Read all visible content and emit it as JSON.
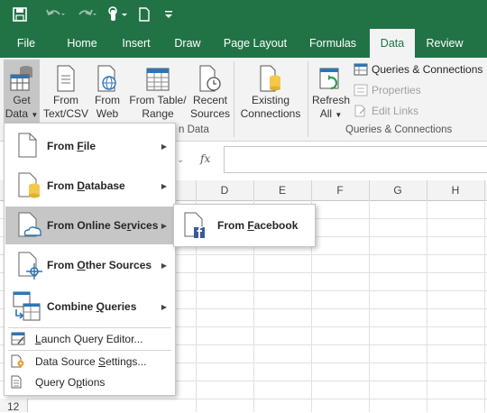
{
  "qat": {
    "undo_icon": "undo-icon",
    "redo_icon": "redo-icon",
    "touch_icon": "touch-mode-icon",
    "new_icon": "new-document-icon"
  },
  "tabs": [
    {
      "label": "File"
    },
    {
      "label": "Home"
    },
    {
      "label": "Insert"
    },
    {
      "label": "Draw"
    },
    {
      "label": "Page Layout"
    },
    {
      "label": "Formulas"
    },
    {
      "label": "Data",
      "active": true
    },
    {
      "label": "Review"
    }
  ],
  "ribbon": {
    "get_data": {
      "line1": "Get",
      "line2": "Data"
    },
    "from_text_csv": {
      "line1": "From",
      "line2": "Text/CSV"
    },
    "from_web": {
      "line1": "From",
      "line2": "Web"
    },
    "from_table_range": {
      "line1": "From Table/",
      "line2": "Range"
    },
    "recent_sources": {
      "line1": "Recent",
      "line2": "Sources"
    },
    "existing_connections": {
      "line1": "Existing",
      "line2": "Connections"
    },
    "refresh_all": {
      "line1": "Refresh",
      "line2": "All"
    },
    "queries_connections": "Queries & Connections",
    "properties": "Properties",
    "edit_links": "Edit Links",
    "group_get_transform_partial": "n Data",
    "group_queries_connections": "Queries & Connections"
  },
  "formula_bar": {
    "fx": "fx"
  },
  "columns": [
    "D",
    "E",
    "F",
    "G",
    "H"
  ],
  "row_partial": "12",
  "menu": {
    "items": [
      {
        "pre": "From ",
        "key": "F",
        "post": "ile"
      },
      {
        "pre": "From ",
        "key": "D",
        "post": "atabase"
      },
      {
        "pre": "From Online Se",
        "key": "r",
        "post": "vices"
      },
      {
        "pre": "From ",
        "key": "O",
        "post": "ther Sources"
      },
      {
        "pre": "Combine ",
        "key": "Q",
        "post": "ueries"
      }
    ],
    "small_items": [
      {
        "pre": "",
        "key": "L",
        "post": "aunch Query Editor..."
      },
      {
        "pre": "Data Source ",
        "key": "S",
        "post": "ettings..."
      },
      {
        "pre": "Query O",
        "key": "p",
        "post": "tions"
      }
    ]
  },
  "submenu": {
    "pre": "From ",
    "key": "F",
    "post": "acebook"
  }
}
